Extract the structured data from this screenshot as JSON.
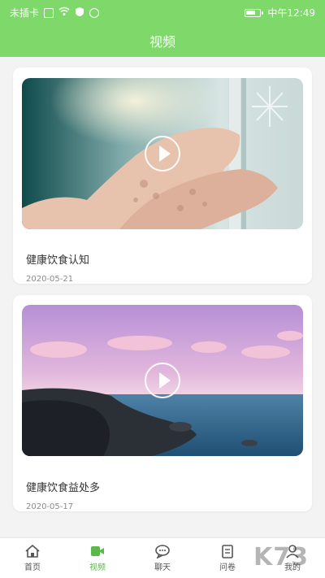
{
  "status_bar": {
    "carrier": "未插卡",
    "time": "中午12:49",
    "icons": [
      "sim-icon",
      "wifi-icon",
      "shield-icon",
      "app-icon",
      "battery-icon"
    ]
  },
  "header": {
    "title": "视频"
  },
  "videos": [
    {
      "title": "健康饮食认知",
      "date": "2020-05-21",
      "thumbnail": "hands-with-snowflake-shadow-image",
      "icon": "play-icon"
    },
    {
      "title": "健康饮食益处多",
      "date": "2020-05-17",
      "thumbnail": "sea-with-pink-clouds-image",
      "icon": "play-icon"
    }
  ],
  "tabbar": {
    "tabs": [
      {
        "label": "首页",
        "icon": "home-icon"
      },
      {
        "label": "视频",
        "icon": "video-icon",
        "active": true
      },
      {
        "label": "聊天",
        "icon": "chat-icon"
      },
      {
        "label": "问卷",
        "icon": "survey-icon"
      },
      {
        "label": "我的",
        "icon": "profile-icon"
      }
    ]
  },
  "watermark": {
    "text": "K73"
  },
  "colors": {
    "brand": "#7ed96a",
    "active_tab": "#5db84b"
  }
}
